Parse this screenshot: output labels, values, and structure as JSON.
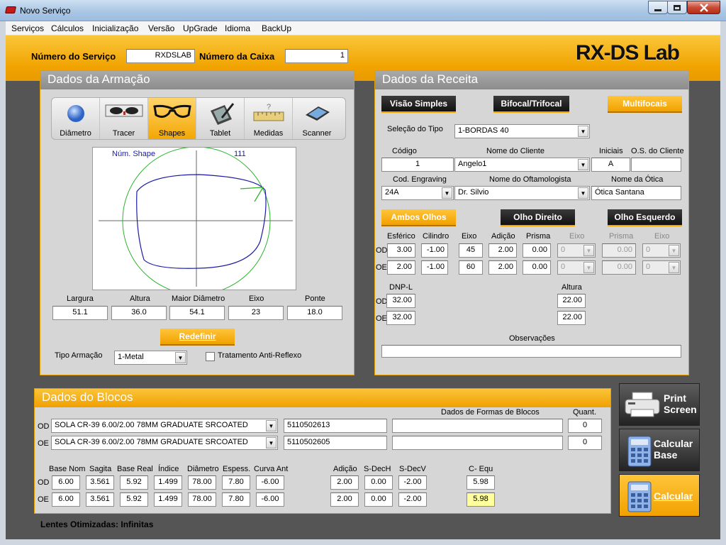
{
  "window": {
    "title": "Novo Serviço"
  },
  "menu": [
    "Serviços",
    "Cálculos",
    "Inicialização",
    "Versão",
    "UpGrade",
    "Idioma",
    "BackUp"
  ],
  "header": {
    "servico_label": "Número do Serviço",
    "servico_value": "RXDSLAB",
    "caixa_label": "Número da Caixa",
    "caixa_value": "1",
    "brand": "RX-DS Lab"
  },
  "armacao": {
    "title": "Dados da Armação",
    "tabs": [
      "Diâmetro",
      "Tracer",
      "Shapes",
      "Tablet",
      "Medidas",
      "Scanner"
    ],
    "active_tab": "Shapes",
    "shape_label": "Núm. Shape",
    "shape_number": "111",
    "measure_labels": [
      "Largura",
      "Altura",
      "Maior Diâmetro",
      "Eixo",
      "Ponte"
    ],
    "measure_values": [
      "51.1",
      "36.0",
      "54.1",
      "23",
      "18.0"
    ],
    "redefinir": "Redefinir",
    "tipo_label": "Tipo Armação",
    "tipo_value": "1-Metal",
    "antireflexo": "Tratamento Anti-Reflexo"
  },
  "receita": {
    "title": "Dados da Receita",
    "tipo_buttons": [
      "Visão Simples",
      "Bifocal/Trifocal",
      "Multifocais"
    ],
    "selecao_label": "Seleção do Tipo",
    "selecao_value": "1-BORDAS 40",
    "codigo_label": "Código",
    "codigo_value": "1",
    "cliente_label": "Nome do Cliente",
    "cliente_value": "Angelo1",
    "iniciais_label": "Iniciais",
    "iniciais_value": "A",
    "os_label": "O.S. do Cliente",
    "os_value": "",
    "engraving_label": "Cod. Engraving",
    "engraving_value": "24A",
    "oftalmo_label": "Nome do Oftamologista",
    "oftalmo_value": "Dr. Silvio",
    "otica_label": "Nome da Ótica",
    "otica_value": "Ótica Santana",
    "olho_buttons": [
      "Ambos Olhos",
      "Olho Direito",
      "Olho Esquerdo"
    ],
    "rx_headers": [
      "Esférico",
      "Cilindro",
      "Eixo",
      "Adição",
      "Prisma",
      "Eixo",
      "Prisma",
      "Eixo"
    ],
    "od_label": "OD",
    "oe_label": "OE",
    "od_values": [
      "3.00",
      "-1.00",
      "45",
      "2.00",
      "0.00",
      "0",
      "0.00",
      "0"
    ],
    "oe_values": [
      "2.00",
      "-1.00",
      "60",
      "2.00",
      "0.00",
      "0",
      "0.00",
      "0"
    ],
    "dnp_label": "DNP-L",
    "altura_label": "Altura",
    "dnp_od": "32.00",
    "dnp_oe": "32.00",
    "alt_od": "22.00",
    "alt_oe": "22.00",
    "obs_label": "Observações",
    "obs_value": ""
  },
  "blocos": {
    "title": "Dados do Blocos",
    "formas_label": "Dados de Formas de Blocos",
    "quant_label": "Quant.",
    "od": {
      "label": "OD",
      "lente": "SOLA CR-39 6.00/2.00 78MM GRADUATE SRCOATED",
      "codigo": "5110502613",
      "formas": "",
      "quant": "0"
    },
    "oe": {
      "label": "OE",
      "lente": "SOLA CR-39 6.00/2.00 78MM GRADUATE SRCOATED",
      "codigo": "5110502605",
      "formas": "",
      "quant": "0"
    },
    "calc_headers": [
      "Base Nom",
      "Sagita",
      "Base Real",
      "Índice",
      "Diâmetro",
      "Espess.",
      "Curva Ant"
    ],
    "calc_od": [
      "6.00",
      "3.561",
      "5.92",
      "1.499",
      "78.00",
      "7.80",
      "-6.00"
    ],
    "calc_oe": [
      "6.00",
      "3.561",
      "5.92",
      "1.499",
      "78.00",
      "7.80",
      "-6.00"
    ],
    "dec_headers": [
      "Adição",
      "S-DecH",
      "S-DecV"
    ],
    "dec_od": [
      "2.00",
      "0.00",
      "-2.00"
    ],
    "dec_oe": [
      "2.00",
      "0.00",
      "-2.00"
    ],
    "cequ_label": "C- Equ",
    "cequ_od": "5.98",
    "cequ_oe": "5.98",
    "otimizadas": "Lentes Otimizadas: Infinitas"
  },
  "side_buttons": {
    "print": [
      "Print",
      "Screen"
    ],
    "calc_base": [
      "Calcular",
      "Base"
    ],
    "calcular": "Calcular"
  },
  "icons": {
    "window_icon": "app-icon",
    "minimize": "minimize-icon",
    "maximize": "maximize-icon",
    "close": "close-icon",
    "printer": "printer-icon",
    "calculator": "calculator-icon"
  }
}
